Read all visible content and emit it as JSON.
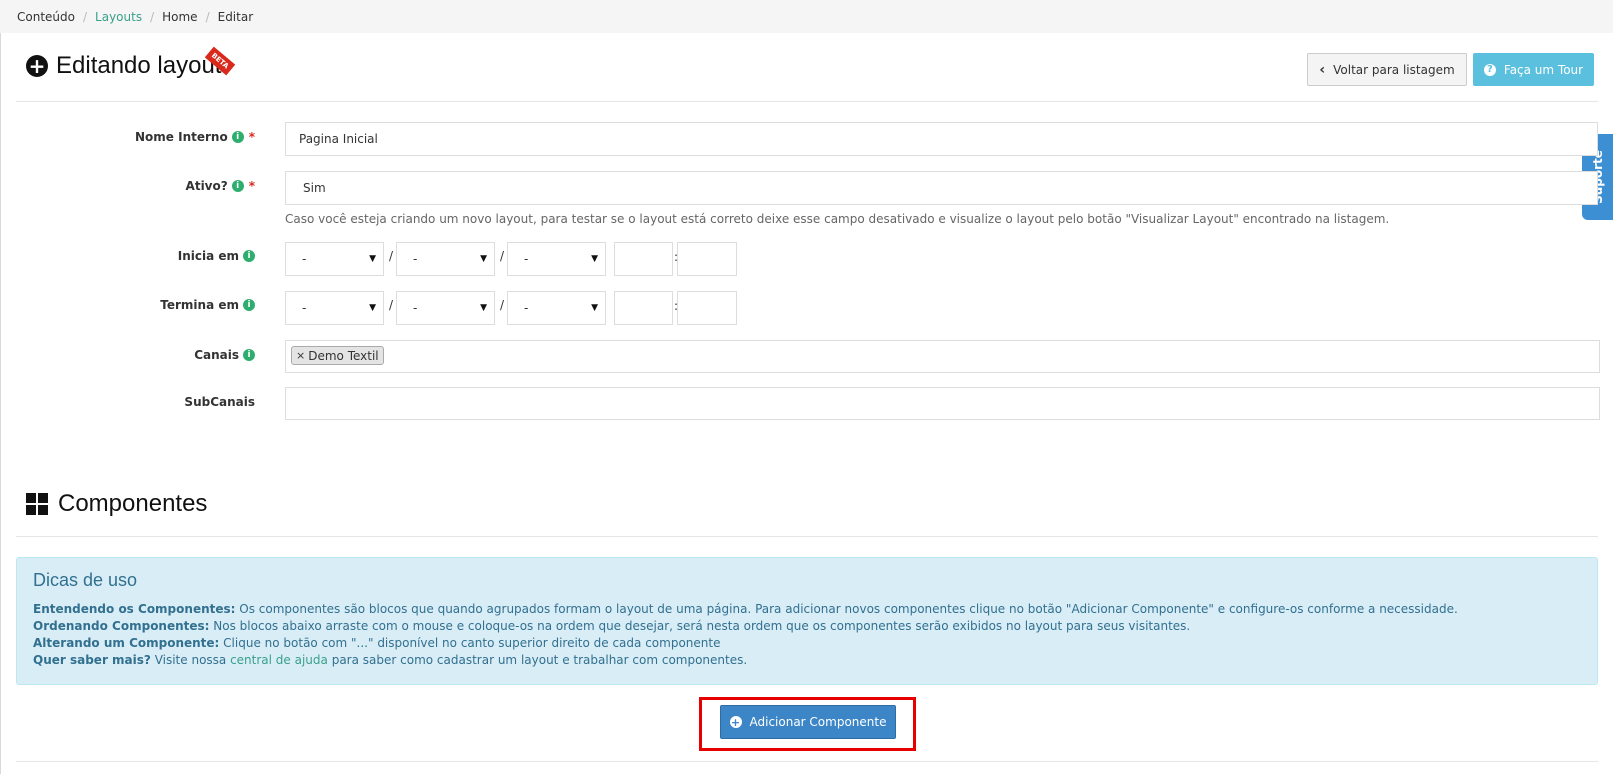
{
  "breadcrumb": [
    {
      "label": "Conteúdo",
      "link": false
    },
    {
      "label": "Layouts",
      "link": true
    },
    {
      "label": "Home",
      "link": false
    },
    {
      "label": "Editar",
      "link": false
    }
  ],
  "header": {
    "title": "Editando layout",
    "badge": "BETA",
    "back_button": "Voltar para listagem",
    "tour_button": "Faça um Tour"
  },
  "support_tab": "Suporte",
  "form": {
    "nome_interno": {
      "label": "Nome Interno",
      "value": "Pagina Inicial"
    },
    "ativo": {
      "label": "Ativo?",
      "value": "Sim",
      "help": "Caso você esteja criando um novo layout, para testar se o layout está correto deixe esse campo desativado e visualize o layout pelo botão \"Visualizar Layout\" encontrado na listagem."
    },
    "inicia_em": {
      "label": "Inicia em",
      "day": "-",
      "month": "-",
      "year": "-",
      "hour": "",
      "minute": ""
    },
    "termina_em": {
      "label": "Termina em",
      "day": "-",
      "month": "-",
      "year": "-",
      "hour": "",
      "minute": ""
    },
    "canais": {
      "label": "Canais",
      "tags": [
        "Demo Textil"
      ]
    },
    "subcanais": {
      "label": "SubCanais",
      "value": ""
    }
  },
  "componentes": {
    "title": "Componentes",
    "tips_title": "Dicas de uso",
    "tips": [
      {
        "bold": "Entendendo os Componentes:",
        "text": " Os componentes são blocos que quando agrupados formam o layout de uma página. Para adicionar novos componentes clique no botão \"Adicionar Componente\" e configure-os conforme a necessidade."
      },
      {
        "bold": "Ordenando Componentes:",
        "text": " Nos blocos abaixo arraste com o mouse e coloque-os na ordem que desejar, será nesta ordem que os componentes serão exibidos no layout para seus visitantes."
      },
      {
        "bold": "Alterando um Componente:",
        "text": " Clique no botão com \"...\" disponível no canto superior direito de cada componente"
      },
      {
        "bold": "Quer saber mais?",
        "pre": " Visite nossa ",
        "link": "central de ajuda",
        "post": " para saber como cadastrar um layout e trabalhar com componentes."
      }
    ],
    "add_button": "Adicionar Componente"
  },
  "colors": {
    "accent_link": "#3aa08a",
    "primary_button": "#3c86c8",
    "info_button": "#5bc0de",
    "required": "#d9281c",
    "highlight_outline": "#e60000",
    "tips_background": "#d9edf7"
  }
}
